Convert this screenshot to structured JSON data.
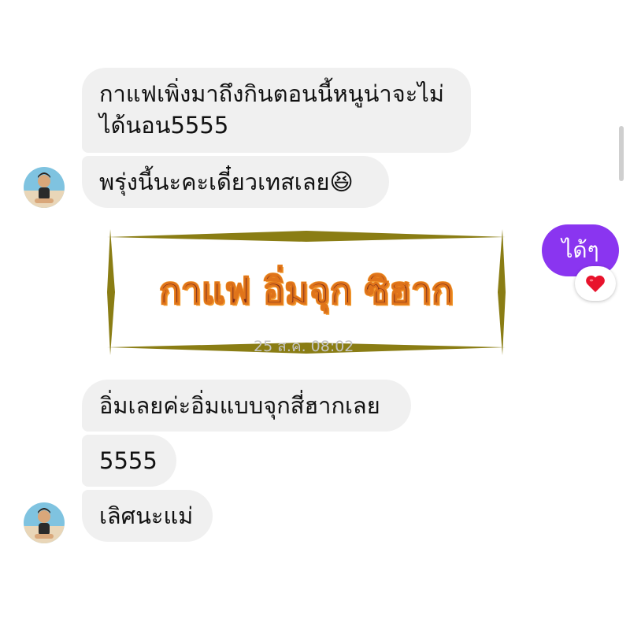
{
  "chat": {
    "messages": [
      {
        "lines": [
          "กาแฟเพิ่งมาถึงกินตอนนี้หนูน่าจะไม่",
          "ได้นอน5555"
        ]
      },
      {
        "text": "พรุ่งนี้นะคะเดี๋ยวเทสเลย😆"
      },
      {
        "text": "อิ่มเลยค่ะอิ่มแบบจุกสี่ฮากเลย"
      },
      {
        "text": "5555"
      },
      {
        "text": "เลิศนะแม่"
      }
    ],
    "sent_message": "ได้ๆ",
    "reaction": "❤️",
    "banner_text": "กาแฟ อิ่มจุก ซิฮาก",
    "timestamp_mid": "25 ส.ค. 08:02"
  },
  "colors": {
    "received_bubble": "#f0f0f0",
    "sent_bubble": "#8a35f0",
    "banner_frame": "#8a7d14",
    "banner_text": "#7a2d1a",
    "banner_outline": "#f29a2e"
  },
  "icons": {
    "avatar": "avatar-photo",
    "reaction": "heart-icon"
  }
}
